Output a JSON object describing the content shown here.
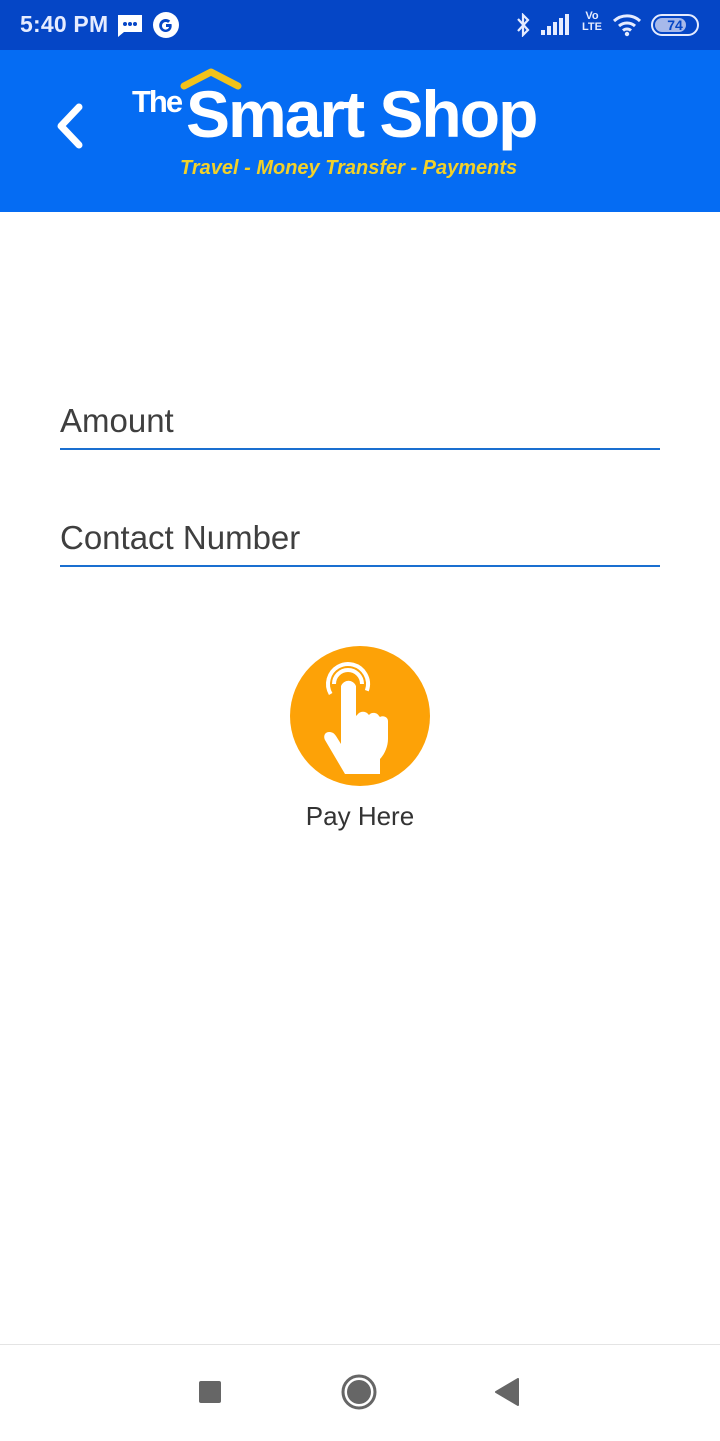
{
  "status_bar": {
    "time": "5:40 PM",
    "left_icons": [
      "message-icon",
      "google-icon"
    ],
    "right_icons": [
      "bluetooth-icon",
      "signal-icon",
      "volte-icon",
      "wifi-icon",
      "battery-icon"
    ],
    "volte_top": "Vo",
    "volte_bottom": "LTE",
    "battery_level": "74"
  },
  "app_bar": {
    "back_icon": "chevron-left-icon",
    "logo": {
      "prefix": "The",
      "name": "Smart Shop",
      "tagline": "Travel - Money Transfer - Payments"
    }
  },
  "form": {
    "amount": {
      "placeholder": "Amount",
      "value": ""
    },
    "contact": {
      "placeholder": "Contact Number",
      "value": ""
    }
  },
  "pay_button": {
    "icon": "tap-hand-icon",
    "label": "Pay Here"
  },
  "nav_bar": {
    "buttons": [
      "recents-button",
      "home-button",
      "back-button"
    ]
  },
  "colors": {
    "status_bar": "#0546c6",
    "app_bar": "#056cf3",
    "accent_yellow": "#f2d12a",
    "field_underline": "#1a6fd0",
    "pay_button": "#fda207"
  }
}
